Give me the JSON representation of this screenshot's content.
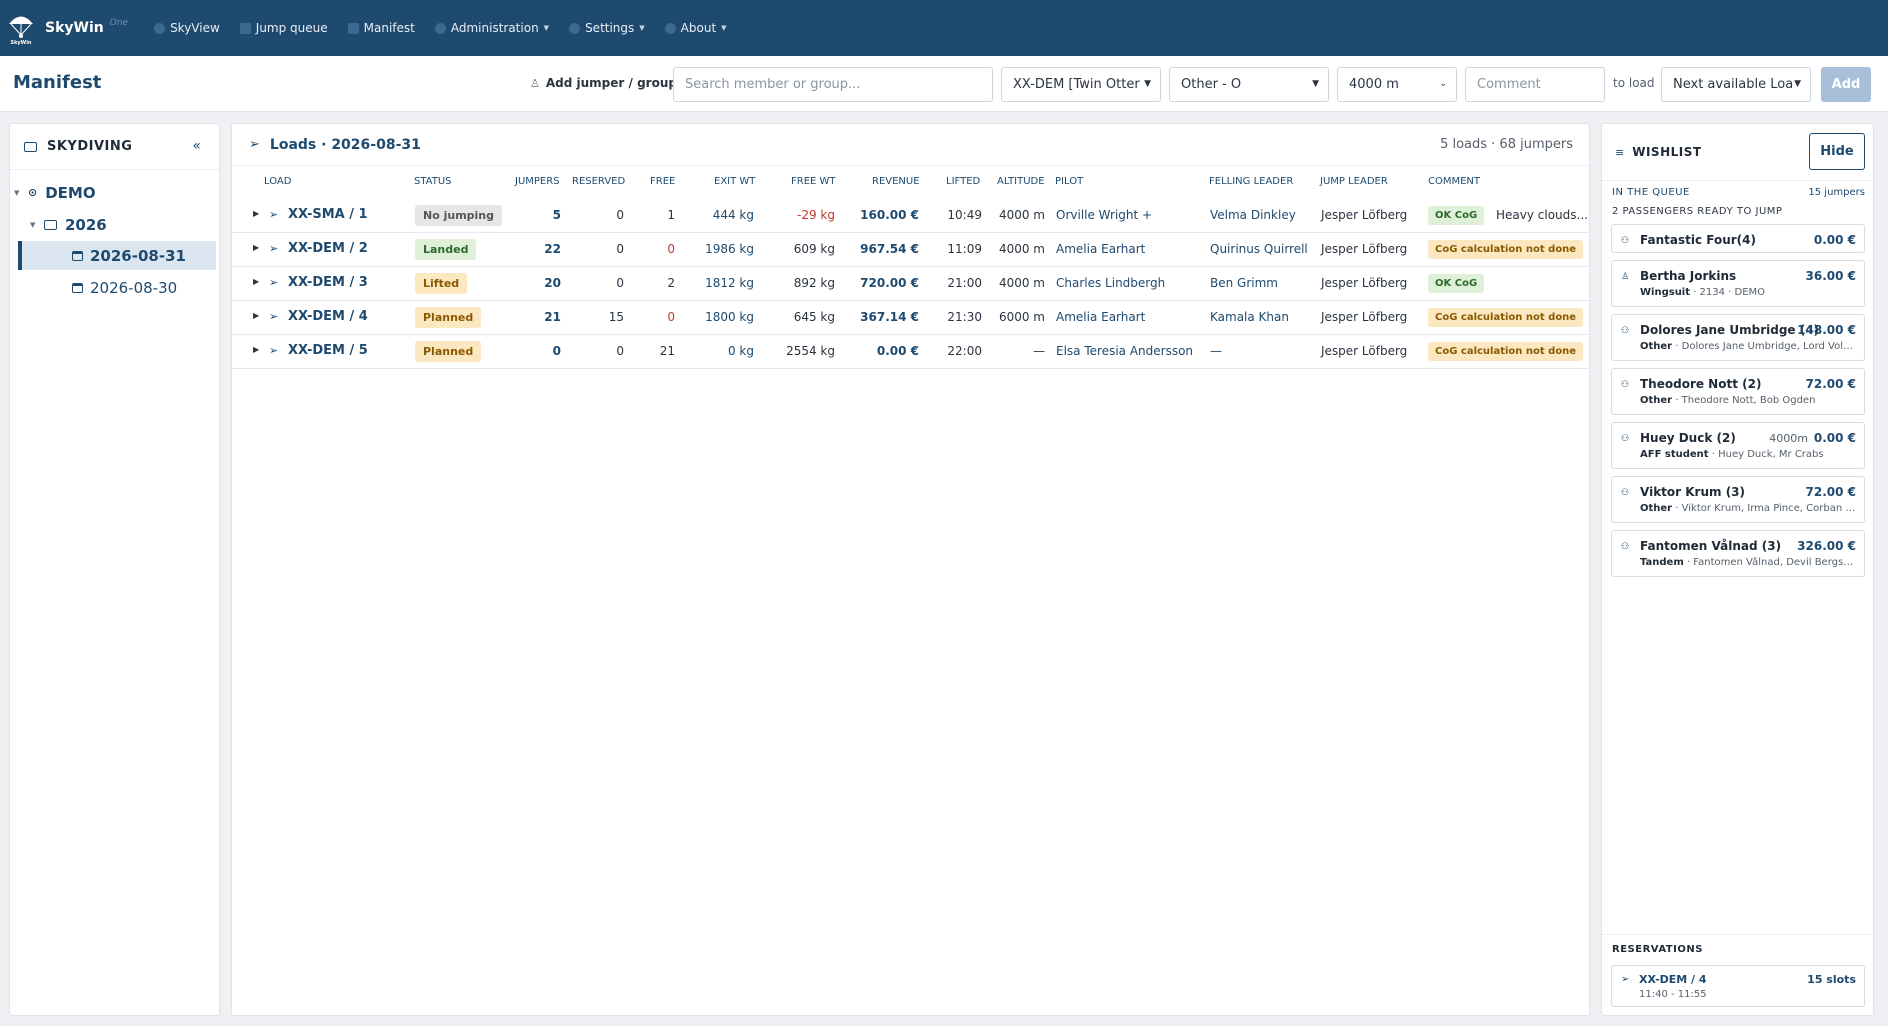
{
  "app": {
    "brand": "SkyWin",
    "brand_sub": "One",
    "logo_text": "SkyWin"
  },
  "nav": {
    "items": [
      {
        "label": "SkyView",
        "dropdown": false
      },
      {
        "label": "Jump queue",
        "dropdown": false
      },
      {
        "label": "Manifest",
        "dropdown": false
      },
      {
        "label": "Administration",
        "dropdown": true
      },
      {
        "label": "Settings",
        "dropdown": true
      },
      {
        "label": "About",
        "dropdown": true
      }
    ]
  },
  "toolbar": {
    "title": "Manifest",
    "add_jumper_label": "Add jumper / group",
    "search_placeholder": "Search member or group...",
    "aircraft_value": "XX-DEM [Twin Otter",
    "jump_type_value": "Other - O",
    "altitude_value": "4000 m",
    "comment_placeholder": "Comment",
    "to_load_label": "to load",
    "target_load_value": "Next available Loa",
    "add_label": "Add"
  },
  "tree": {
    "title": "SKYDIVING",
    "dropzone": "DEMO",
    "year": "2026",
    "dates": [
      "2026-08-31",
      "2026-08-30"
    ],
    "active_date": "2026-08-31"
  },
  "loads": {
    "title": "Loads · 2026-08-31",
    "summary": "5 loads · 68 jumpers",
    "columns": [
      "Load",
      "Status",
      "Jumpers",
      "Reserved",
      "Free",
      "Exit wt",
      "Free wt",
      "Revenue",
      "Lifted",
      "Altitude",
      "Pilot",
      "Felling leader",
      "Jump leader",
      "Comment"
    ],
    "rows": [
      {
        "load": "XX-SMA / 1",
        "status": "No jumping",
        "status_kind": "gray",
        "jumpers": "5",
        "reserved": "0",
        "free": "1",
        "free_neg": false,
        "exit_wt": "444 kg",
        "free_wt": "-29 kg",
        "free_wt_neg": true,
        "revenue": "160.00 €",
        "lifted": "10:49",
        "altitude": "4000 m",
        "pilot": "Orville Wright +",
        "felling_leader": "Velma Dinkley",
        "jump_leader": "Jesper Löfberg",
        "cog": "OK CoG",
        "cog_kind": "ok",
        "comment": "Heavy clouds..."
      },
      {
        "load": "XX-DEM / 2",
        "status": "Landed",
        "status_kind": "green",
        "jumpers": "22",
        "reserved": "0",
        "free": "0",
        "free_neg": true,
        "exit_wt": "1986 kg",
        "free_wt": "609 kg",
        "free_wt_neg": false,
        "revenue": "967.54 €",
        "lifted": "11:09",
        "altitude": "4000 m",
        "pilot": "Amelia Earhart",
        "felling_leader": "Quirinus Quirrell",
        "jump_leader": "Jesper Löfberg",
        "cog": "CoG calculation not done",
        "cog_kind": "warn",
        "comment": ""
      },
      {
        "load": "XX-DEM / 3",
        "status": "Lifted",
        "status_kind": "yellow",
        "jumpers": "20",
        "reserved": "0",
        "free": "2",
        "free_neg": false,
        "exit_wt": "1812 kg",
        "free_wt": "892 kg",
        "free_wt_neg": false,
        "revenue": "720.00 €",
        "lifted": "21:00",
        "altitude": "4000 m",
        "pilot": "Charles Lindbergh",
        "felling_leader": "Ben Grimm",
        "jump_leader": "Jesper Löfberg",
        "cog": "OK CoG",
        "cog_kind": "ok",
        "comment": ""
      },
      {
        "load": "XX-DEM / 4",
        "status": "Planned",
        "status_kind": "yellow",
        "jumpers": "21",
        "reserved": "15",
        "free": "0",
        "free_neg": true,
        "exit_wt": "1800 kg",
        "free_wt": "645 kg",
        "free_wt_neg": false,
        "revenue": "367.14 €",
        "lifted": "21:30",
        "altitude": "6000 m",
        "pilot": "Amelia Earhart",
        "felling_leader": "Kamala Khan",
        "jump_leader": "Jesper Löfberg",
        "cog": "CoG calculation not done",
        "cog_kind": "warn",
        "comment": ""
      },
      {
        "load": "XX-DEM / 5",
        "status": "Planned",
        "status_kind": "yellow",
        "jumpers": "0",
        "reserved": "0",
        "free": "21",
        "free_neg": false,
        "exit_wt": "0 kg",
        "free_wt": "2554 kg",
        "free_wt_neg": false,
        "revenue": "0.00 €",
        "lifted": "22:00",
        "altitude": "—",
        "pilot": "Elsa Teresia Andersson",
        "felling_leader": "—",
        "jump_leader": "Jesper Löfberg",
        "cog": "CoG calculation not done",
        "cog_kind": "warn",
        "comment": ""
      }
    ]
  },
  "wishlist": {
    "title": "WISHLIST",
    "hide_label": "Hide",
    "queue_label": "IN THE QUEUE",
    "queue_count": "15 jumpers",
    "ready_label": "2 PASSENGERS READY TO JUMP",
    "items": [
      {
        "name": "Fantastic Four(4)",
        "price": "0.00 €",
        "type": "",
        "detail": "",
        "altitude": "",
        "group": true
      },
      {
        "name": "Bertha Jorkins",
        "price": "36.00 €",
        "type": "Wingsuit",
        "detail": " · 2134 · DEMO",
        "altitude": "",
        "group": false
      },
      {
        "name": "Dolores Jane Umbridge (4)",
        "price": "148.00 €",
        "type": "Other",
        "detail": " · Dolores Jane Umbridge, Lord Vold...",
        "altitude": "",
        "group": true
      },
      {
        "name": "Theodore Nott (2)",
        "price": "72.00 €",
        "type": "Other",
        "detail": " · Theodore Nott, Bob Ogden",
        "altitude": "",
        "group": true
      },
      {
        "name": "Huey Duck (2)",
        "price": "0.00 €",
        "type": "AFF student",
        "detail": " · Huey Duck, Mr Crabs",
        "altitude": "4000m",
        "group": true
      },
      {
        "name": "Viktor Krum (3)",
        "price": "72.00 €",
        "type": "Other",
        "detail": " · Viktor Krum, Irma Pince, Corban Ya...",
        "altitude": "",
        "group": true
      },
      {
        "name": "Fantomen Vålnad (3)",
        "price": "326.00 €",
        "type": "Tandem",
        "detail": " · Fantomen Vålnad, Devil Bergsvar...",
        "altitude": "",
        "group": true
      }
    ],
    "reservations_label": "RESERVATIONS",
    "reservation": {
      "load": "XX-DEM / 4",
      "slots": "15 slots",
      "time": "11:40 - 11:55"
    }
  }
}
